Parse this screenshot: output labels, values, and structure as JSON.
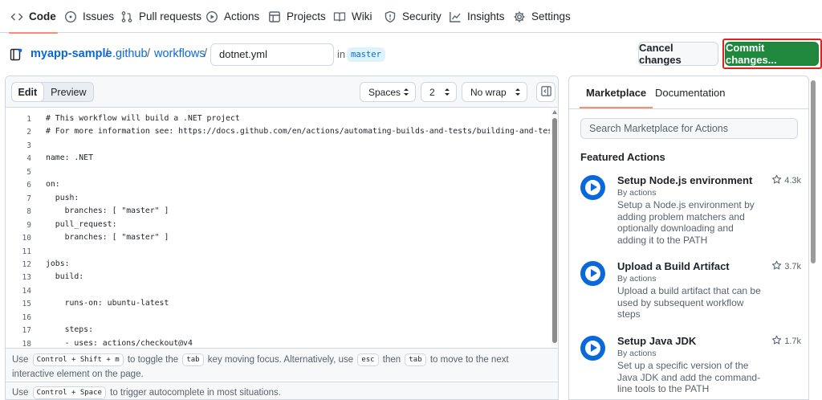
{
  "nav": {
    "tabs": [
      {
        "label": "Code",
        "icon": "code-icon"
      },
      {
        "label": "Issues",
        "icon": "issue-icon"
      },
      {
        "label": "Pull requests",
        "icon": "pull-request-icon"
      },
      {
        "label": "Actions",
        "icon": "play-icon"
      },
      {
        "label": "Projects",
        "icon": "table-icon"
      },
      {
        "label": "Wiki",
        "icon": "book-icon"
      },
      {
        "label": "Security",
        "icon": "shield-icon"
      },
      {
        "label": "Insights",
        "icon": "graph-icon"
      },
      {
        "label": "Settings",
        "icon": "gear-icon"
      }
    ]
  },
  "breadcrumb": {
    "repo": "myapp-sample",
    "dir1": ".github",
    "dir2": "workflows",
    "sep": "/",
    "filename": "dotnet.yml",
    "in_label": "in",
    "branch": "master"
  },
  "actions": {
    "cancel_label": "Cancel changes",
    "commit_label": "Commit changes..."
  },
  "editor": {
    "mode_edit": "Edit",
    "mode_preview": "Preview",
    "indent_mode": "Spaces",
    "indent_size": "2",
    "wrap_mode": "No wrap",
    "lines": [
      "# This workflow will build a .NET project",
      "# For more information see: https://docs.github.com/en/actions/automating-builds-and-tests/building-and-testing-net",
      "",
      "name: .NET",
      "",
      "on:",
      "  push:",
      "    branches: [ \"master\" ]",
      "  pull_request:",
      "    branches: [ \"master\" ]",
      "",
      "jobs:",
      "  build:",
      "",
      "    runs-on: ubuntu-latest",
      "",
      "    steps:",
      "    - uses: actions/checkout@v4"
    ],
    "hint1": {
      "pre": "Use",
      "k1": "Control + Shift + m",
      "mid1": "to toggle the",
      "k2": "tab",
      "mid2": "key moving focus. Alternatively, use",
      "k3": "esc",
      "mid3": "then",
      "k4": "tab",
      "post": "to move to the next interactive element on the page."
    },
    "hint2": {
      "pre": "Use",
      "k1": "Control + Space",
      "post": "to trigger autocomplete in most situations."
    }
  },
  "side": {
    "tab_marketplace": "Marketplace",
    "tab_docs": "Documentation",
    "search_placeholder": "Search Marketplace for Actions",
    "featured_heading": "Featured Actions",
    "items": [
      {
        "title": "Setup Node.js environment",
        "by": "By actions",
        "desc": "Setup a Node.js environment by adding problem matchers and optionally downloading and adding it to the PATH",
        "stars": "4.3k"
      },
      {
        "title": "Upload a Build Artifact",
        "by": "By actions",
        "desc": "Upload a build artifact that can be used by subsequent workflow steps",
        "stars": "3.7k"
      },
      {
        "title": "Setup Java JDK",
        "by": "By actions",
        "desc": "Set up a specific version of the Java JDK and add the command-line tools to the PATH",
        "stars": "1.7k"
      }
    ]
  },
  "colors": {
    "accent": "#0969da",
    "commit_green": "#1f883d",
    "highlight_red": "#e0231a",
    "tab_underline": "#fd8c73"
  }
}
